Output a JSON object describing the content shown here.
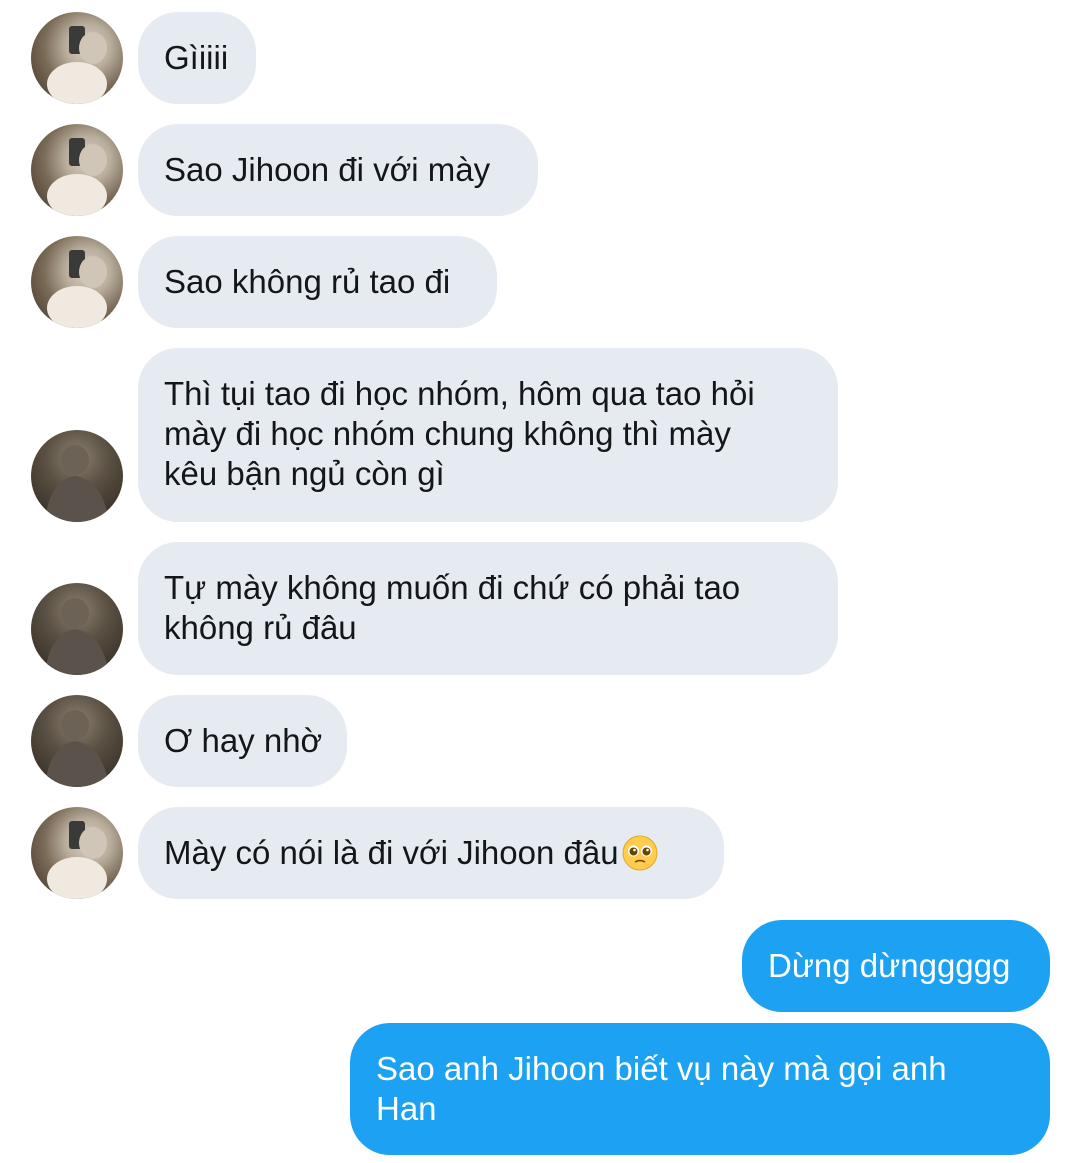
{
  "messages": [
    {
      "sender": "friend_a",
      "lines": [
        "Gìiiii"
      ]
    },
    {
      "sender": "friend_a",
      "lines": [
        "Sao Jihoon đi với mày"
      ]
    },
    {
      "sender": "friend_a",
      "lines": [
        "Sao không rủ tao đi"
      ]
    },
    {
      "sender": "friend_b",
      "lines": [
        "Thì tụi tao đi học nhóm, hôm qua tao hỏi",
        "mày đi học nhóm chung không thì mày",
        "kêu bận ngủ còn gì"
      ]
    },
    {
      "sender": "friend_b",
      "lines": [
        "Tự mày không muốn đi chứ có phải tao",
        "không rủ đâu"
      ]
    },
    {
      "sender": "friend_b",
      "lines": [
        "Ơ hay nhờ"
      ]
    },
    {
      "sender": "friend_a",
      "lines": [
        "Mày có nói là đi với Jihoon đâu"
      ],
      "emoji": "pleading-face-emoji"
    },
    {
      "sender": "me",
      "lines": [
        "Dừng dừnggggg"
      ]
    },
    {
      "sender": "me",
      "lines": [
        "Sao anh Jihoon biết vụ này mà gọi anh",
        "Han"
      ]
    }
  ],
  "colors": {
    "incoming_bubble": "#e6ebf1",
    "incoming_text": "#14171a",
    "outgoing_bubble": "#1da1f2",
    "outgoing_text": "#ffffff"
  }
}
